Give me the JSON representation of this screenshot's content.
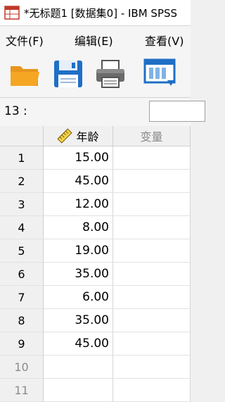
{
  "window": {
    "title": "*无标题1 [数据集0] - IBM SPSS"
  },
  "menu": [
    {
      "label": "文件(F)"
    },
    {
      "label": "编辑(E)"
    },
    {
      "label": "查看(V)"
    }
  ],
  "cell_ref": "13 :",
  "columns": [
    {
      "label": "年龄",
      "icon": "ruler-icon"
    },
    {
      "label": "变量"
    }
  ],
  "rows": [
    {
      "num": "1",
      "value": "15.00"
    },
    {
      "num": "2",
      "value": "45.00"
    },
    {
      "num": "3",
      "value": "12.00"
    },
    {
      "num": "4",
      "value": "8.00"
    },
    {
      "num": "5",
      "value": "19.00"
    },
    {
      "num": "6",
      "value": "35.00"
    },
    {
      "num": "7",
      "value": "6.00"
    },
    {
      "num": "8",
      "value": "35.00"
    },
    {
      "num": "9",
      "value": "45.00"
    },
    {
      "num": "10",
      "value": ""
    },
    {
      "num": "11",
      "value": ""
    }
  ],
  "colors": {
    "accent_blue": "#1f6fc6",
    "folder_orange": "#f5a623"
  }
}
